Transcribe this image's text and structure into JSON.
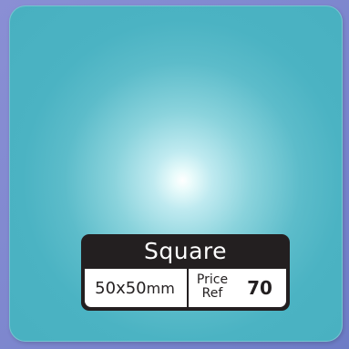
{
  "product": {
    "title": "Square",
    "size": "50x50",
    "size_unit": "mm",
    "price_ref_label_line1": "Price",
    "price_ref_label_line2": "Ref",
    "price_ref_value": "70"
  },
  "colors": {
    "swatch": "#48b0c0",
    "highlight": "#ffffff",
    "background": "#7f88cf",
    "label_dark": "#231f20",
    "label_light": "#ffffff"
  }
}
